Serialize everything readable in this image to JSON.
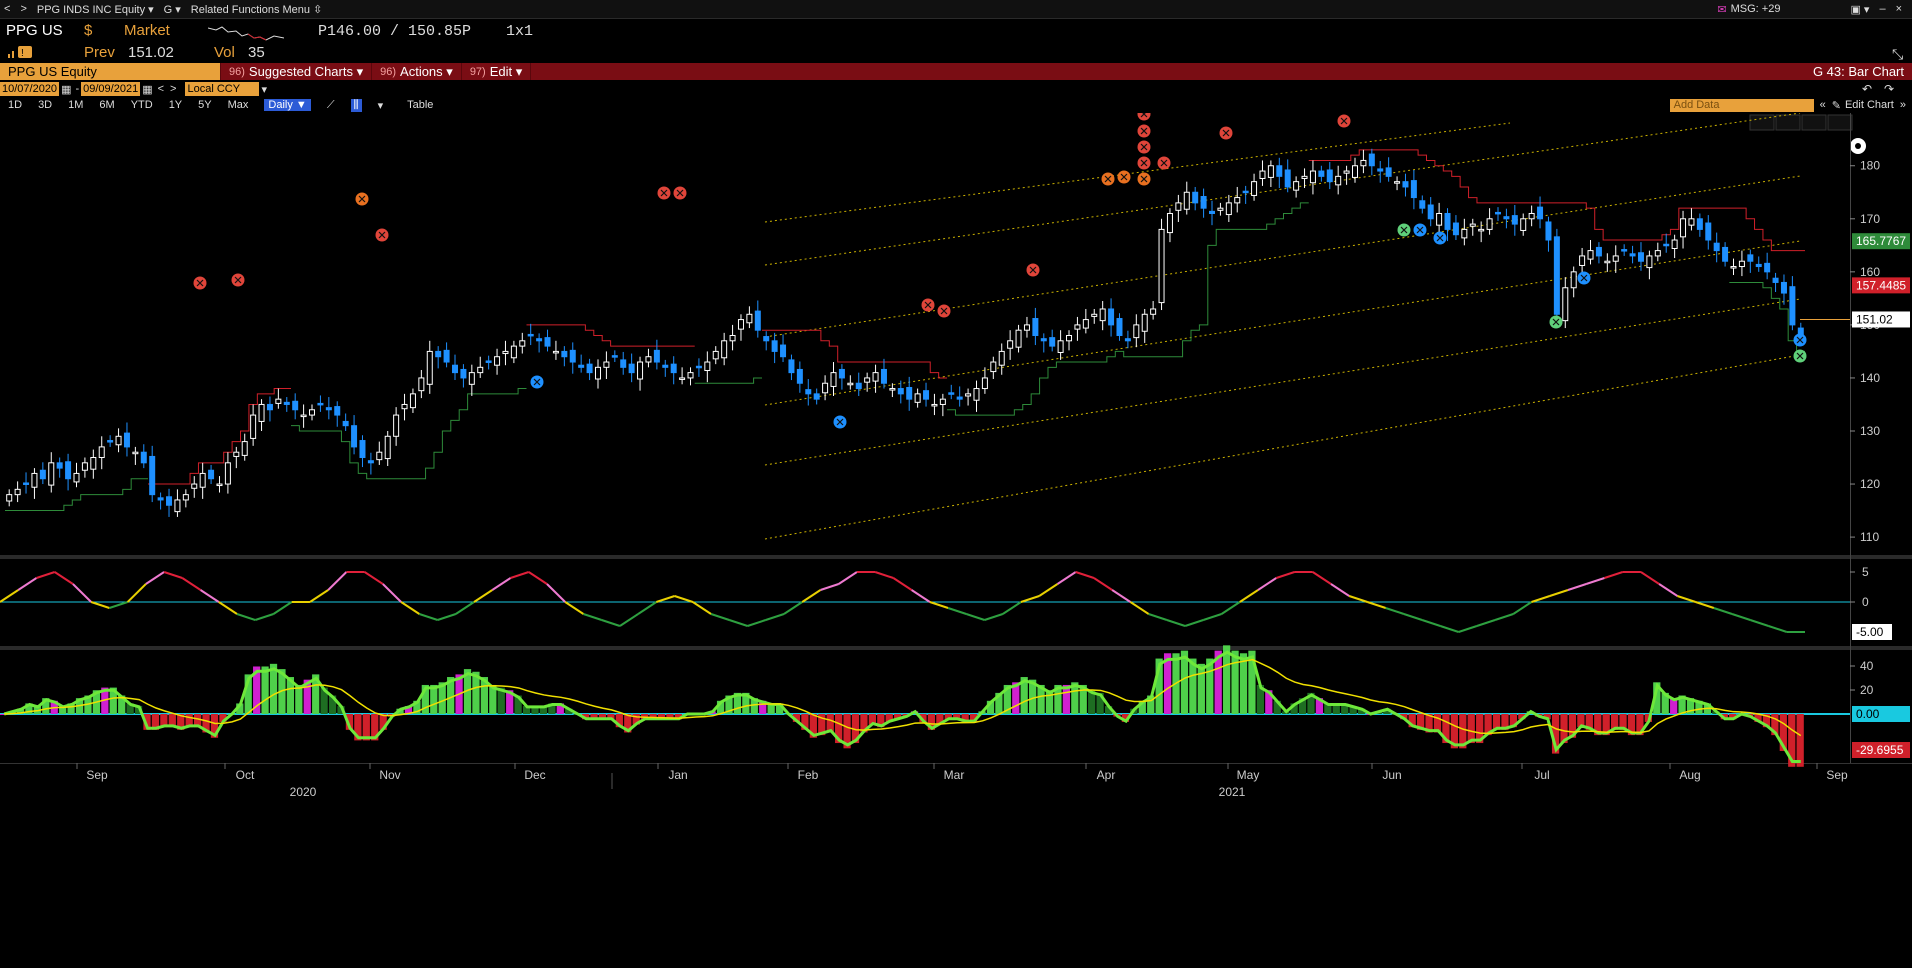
{
  "topbar": {
    "ticker_menu": "PPG INDS INC Equity ▾",
    "g_menu": "G ▾",
    "related_menu": "Related Functions Menu ⇳",
    "msg_label": "MSG: +29"
  },
  "quote": {
    "ticker": "PPG US",
    "currency": "$",
    "market_label": "Market",
    "bid_ask": "P146.00 / 150.85P",
    "size": "1x1",
    "prev_label": "Prev",
    "prev_value": "151.02",
    "vol_label": "Vol",
    "vol_value": "35"
  },
  "toolbar": {
    "security": "PPG US Equity",
    "suggested_num": "96)",
    "suggested": "Suggested Charts",
    "actions_num": "96)",
    "actions": "Actions",
    "edit_num": "97)",
    "edit": "Edit",
    "chart_name": "G 43: Bar Chart"
  },
  "dates": {
    "start": "10/07/2020",
    "end": "09/09/2021",
    "ccy": "Local CCY"
  },
  "range": {
    "buttons": [
      "1D",
      "3D",
      "1M",
      "6M",
      "YTD",
      "1Y",
      "5Y",
      "Max"
    ],
    "interval": "Daily ▼",
    "table": "Table",
    "add_data_placeholder": "Add Data",
    "edit_chart": "Edit Chart"
  },
  "chart_data": {
    "type": "candlestick",
    "main_axis": {
      "ylim": [
        107,
        189
      ],
      "ticks": [
        110,
        120,
        130,
        140,
        150,
        160,
        170,
        180
      ]
    },
    "price_tags": [
      {
        "value": "165.7767",
        "color": "#2e8b3a"
      },
      {
        "value": "157.4485",
        "color": "#d0202a"
      },
      {
        "value": "151.02",
        "color": "#ffffff"
      }
    ],
    "osc_axis": {
      "ticks": [
        "5",
        "0"
      ],
      "tag": "-5.00"
    },
    "macd_axis": {
      "ticks": [
        "40",
        "20"
      ],
      "tags": [
        {
          "value": "0.00",
          "color": "#19c9e0"
        },
        {
          "value": "-29.6955",
          "color": "#d0202a"
        }
      ]
    },
    "x_months": [
      "Sep",
      "Oct",
      "Nov",
      "Dec",
      "Jan",
      "Feb",
      "Mar",
      "Apr",
      "May",
      "Jun",
      "Jul",
      "Aug",
      "Sep"
    ],
    "x_years": [
      "2020",
      "2021"
    ],
    "closes": [
      118,
      119,
      120,
      122,
      121,
      124,
      123,
      121,
      122,
      124,
      125,
      127,
      128,
      129,
      127,
      126,
      124,
      118,
      117,
      116,
      117,
      118,
      120,
      122,
      121,
      120,
      124,
      126,
      128,
      133,
      135,
      134,
      136,
      135,
      134,
      133,
      134,
      135,
      134,
      133,
      131,
      127,
      125,
      124,
      126,
      129,
      133,
      135,
      137,
      140,
      145,
      144,
      143,
      141,
      140,
      141,
      142,
      143,
      144,
      145,
      146,
      147,
      148,
      147,
      146,
      145,
      144,
      143,
      142,
      141,
      142,
      143,
      144,
      142,
      141,
      143,
      144,
      143,
      142,
      141,
      140,
      141,
      142,
      143,
      145,
      147,
      148,
      151,
      152,
      149,
      147,
      145,
      144,
      141,
      139,
      137,
      136,
      139,
      141,
      140,
      139,
      138,
      140,
      141,
      139,
      138,
      137,
      136,
      137,
      136,
      135,
      136,
      137,
      136,
      137,
      138,
      140,
      143,
      145,
      147,
      149,
      150,
      148,
      147,
      146,
      147,
      148,
      150,
      151,
      152,
      153,
      150,
      148,
      147,
      150,
      152,
      153,
      168,
      171,
      173,
      175,
      173,
      172,
      171,
      172,
      173,
      174,
      175,
      177,
      179,
      180,
      178,
      176,
      177,
      178,
      179,
      178,
      177,
      178,
      179,
      180,
      181,
      180,
      179,
      178,
      177,
      176,
      174,
      172,
      170,
      171,
      168,
      167,
      168,
      169,
      168,
      170,
      171,
      170,
      169,
      170,
      171,
      170,
      166,
      152,
      157,
      160,
      163,
      164,
      163,
      162,
      163,
      164,
      163,
      162,
      163,
      164,
      165,
      166,
      170,
      170,
      168,
      166,
      164,
      162,
      161,
      162,
      162,
      161,
      160,
      158,
      156,
      150,
      148
    ],
    "overlay_lines": "upper/lower regression channel, trailing stops (red/green)",
    "osc_values": [
      0,
      2,
      4,
      5,
      3,
      0,
      -1,
      0,
      3,
      5,
      4,
      2,
      0,
      -2,
      -3,
      -2,
      0,
      0,
      2,
      5,
      5,
      3,
      0,
      -2,
      -3,
      -2,
      0,
      2,
      4,
      5,
      3,
      0,
      -2,
      -3,
      -4,
      -2,
      0,
      1,
      0,
      -2,
      -3,
      -4,
      -3,
      -2,
      0,
      2,
      3,
      5,
      5,
      4,
      2,
      0,
      -1,
      -2,
      -3,
      -2,
      0,
      1,
      3,
      5,
      4,
      2,
      0,
      -2,
      -3,
      -4,
      -3,
      -2,
      0,
      2,
      4,
      5,
      5,
      3,
      1,
      0,
      -1,
      -2,
      -3,
      -4,
      -5,
      -4,
      -3,
      -2,
      0,
      1,
      2,
      3,
      4,
      5,
      5,
      3,
      1,
      0,
      -1,
      -2,
      -3,
      -4,
      -5,
      -5
    ]
  }
}
